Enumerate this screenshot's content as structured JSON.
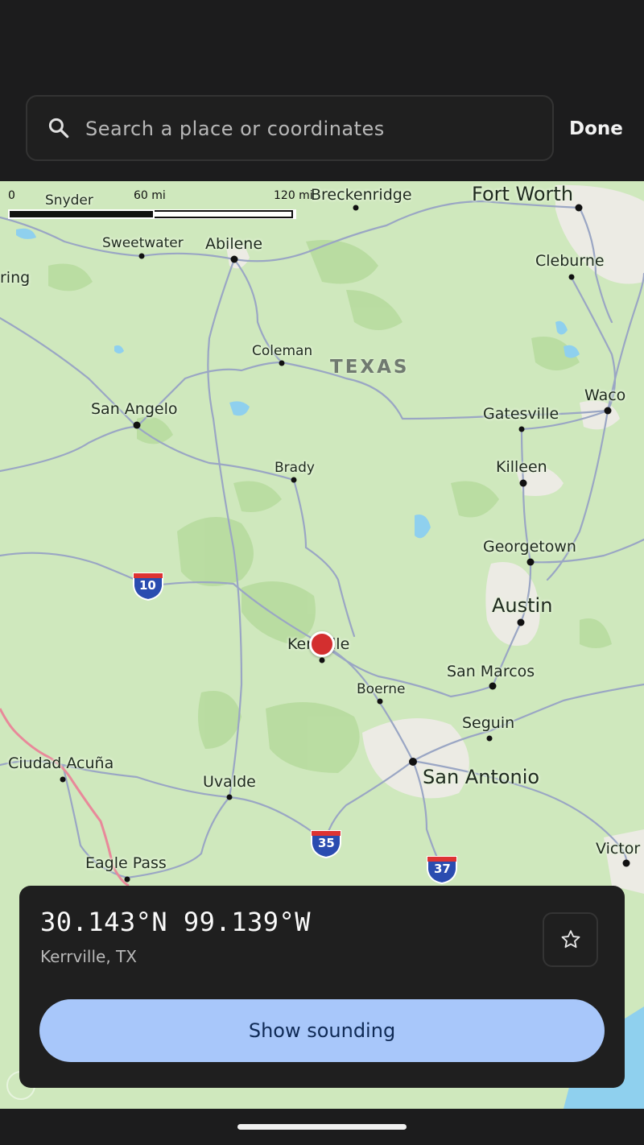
{
  "search": {
    "placeholder": "Search a place or coordinates"
  },
  "header": {
    "done_label": "Done"
  },
  "map": {
    "state_label": "TEXAS",
    "scale": {
      "zero": "0",
      "mid": "60 mi",
      "max": "120 mi"
    },
    "places": [
      {
        "key": "snyder",
        "label": "Snyder"
      },
      {
        "key": "breckenridge",
        "label": "Breckenridge"
      },
      {
        "key": "fort_worth",
        "label": "Fort Worth"
      },
      {
        "key": "sweetwater",
        "label": "Sweetwater"
      },
      {
        "key": "abilene",
        "label": "Abilene"
      },
      {
        "key": "cleburne",
        "label": "Cleburne"
      },
      {
        "key": "spring",
        "label": "ring"
      },
      {
        "key": "coleman",
        "label": "Coleman"
      },
      {
        "key": "waco",
        "label": "Waco"
      },
      {
        "key": "san_angelo",
        "label": "San Angelo"
      },
      {
        "key": "gatesville",
        "label": "Gatesville"
      },
      {
        "key": "brady",
        "label": "Brady"
      },
      {
        "key": "killeen",
        "label": "Killeen"
      },
      {
        "key": "georgetown",
        "label": "Georgetown"
      },
      {
        "key": "austin",
        "label": "Austin"
      },
      {
        "key": "kerrville",
        "label": "Kerrville"
      },
      {
        "key": "san_marcos",
        "label": "San Marcos"
      },
      {
        "key": "boerne",
        "label": "Boerne"
      },
      {
        "key": "seguin",
        "label": "Seguin"
      },
      {
        "key": "ciudad_acuna",
        "label": "Ciudad Acuña"
      },
      {
        "key": "uvalde",
        "label": "Uvalde"
      },
      {
        "key": "san_antonio",
        "label": "San Antonio"
      },
      {
        "key": "victoria",
        "label": "Victor"
      },
      {
        "key": "eagle_pass",
        "label": "Eagle Pass"
      }
    ],
    "highways": [
      {
        "key": "i10",
        "label": "10"
      },
      {
        "key": "i35",
        "label": "35"
      },
      {
        "key": "i37",
        "label": "37"
      }
    ],
    "colors": {
      "land": "#cfe8bd",
      "forest": "#b4d99a",
      "urban": "#e9e8e2",
      "water": "#8fd0ee",
      "road": "#9aa6c4",
      "border": "#e8899a"
    }
  },
  "location": {
    "coordinates": "30.143°N 99.139°W",
    "place": "Kerrville, TX",
    "star_icon": "star-outline-icon",
    "action_label": "Show sounding"
  }
}
